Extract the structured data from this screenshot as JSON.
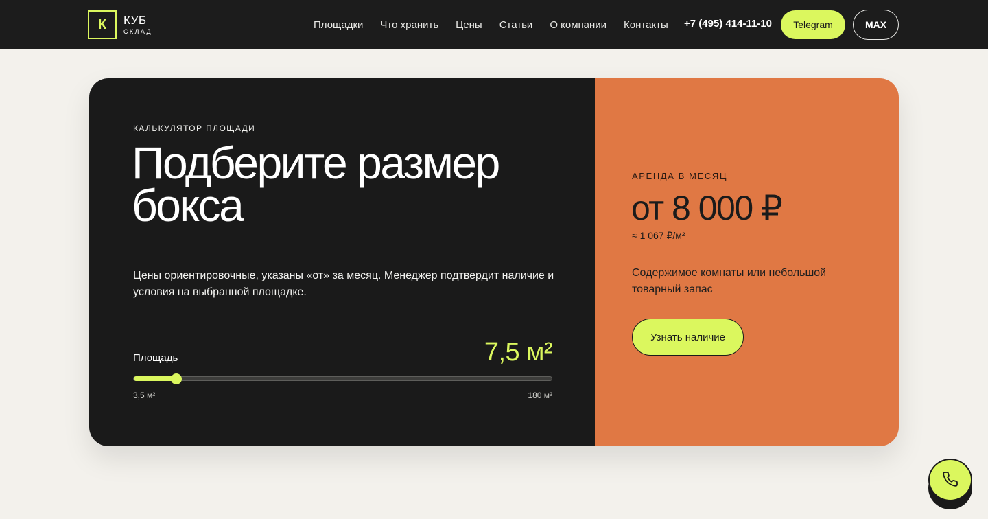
{
  "header": {
    "logo": {
      "mark": "К",
      "title": "КУБ",
      "subtitle": "СКЛАД"
    },
    "nav": [
      {
        "label": "Площадки"
      },
      {
        "label": "Что хранить"
      },
      {
        "label": "Цены"
      },
      {
        "label": "Статьи"
      },
      {
        "label": "О компании"
      },
      {
        "label": "Контакты"
      }
    ],
    "phone": "+7 (495) 414-11-10",
    "telegram_label": "Telegram",
    "max_label": "MAX"
  },
  "calculator": {
    "eyebrow": "КАЛЬКУЛЯТОР ПЛОЩАДИ",
    "headline": "Подберите размер бокса",
    "description": "Цены ориентировочные, указаны «от» за месяц. Менеджер подтвердит наличие и условия на выбранной площадке.",
    "area_label": "Площадь",
    "area_value": "7,5 м²",
    "slider": {
      "min_label": "3,5 м²",
      "max_label": "180 м²",
      "fraction": 0.102
    }
  },
  "rent": {
    "label": "АРЕНДА В МЕСЯЦ",
    "price": "от 8 000 ₽",
    "per_m2": "≈ 1 067 ₽/м²",
    "note": "Содержимое комнаты или небольшой товарный запас",
    "button_label": "Узнать наличие"
  },
  "call_button": {
    "icon": "phone-icon"
  },
  "colors": {
    "accent": "#dbf75e",
    "dark": "#1a1a1a",
    "orange": "#e07844",
    "page_bg": "#f3f1ec"
  }
}
